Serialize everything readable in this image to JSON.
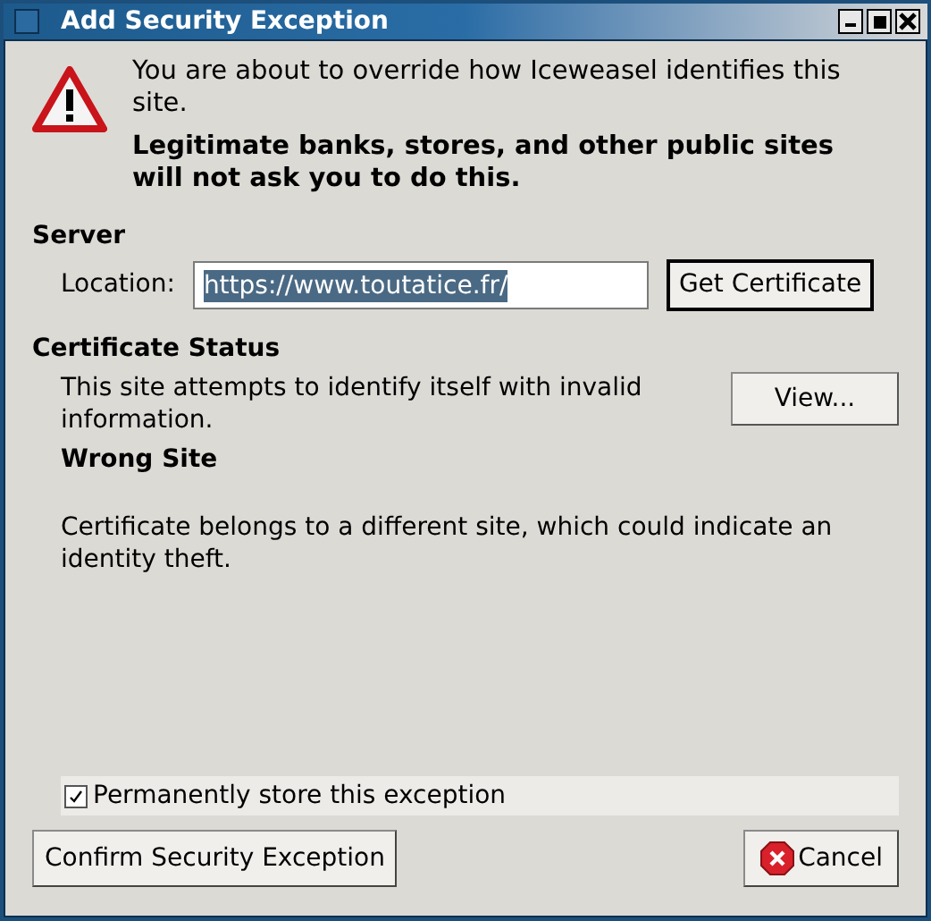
{
  "window": {
    "title": "Add Security Exception"
  },
  "warning": {
    "message": "You are about to override how Iceweasel identifies this site.",
    "emphasis": "Legitimate banks, stores, and other public sites will not ask you to do this."
  },
  "server": {
    "heading": "Server",
    "location_label": "Location:",
    "location_value": "https://www.toutatice.fr/",
    "location_selected": true,
    "get_certificate_button": "Get Certificate"
  },
  "certificate_status": {
    "heading": "Certificate Status",
    "summary": "This site attempts to identify itself with invalid information.",
    "view_button": "View...",
    "problem_title": "Wrong Site",
    "problem_text": "Certificate belongs to a different site, which could indicate an identity theft."
  },
  "permanent_store": {
    "label": "Permanently store this exception",
    "checked": true
  },
  "buttons": {
    "confirm": "Confirm Security Exception",
    "cancel": "Cancel"
  }
}
